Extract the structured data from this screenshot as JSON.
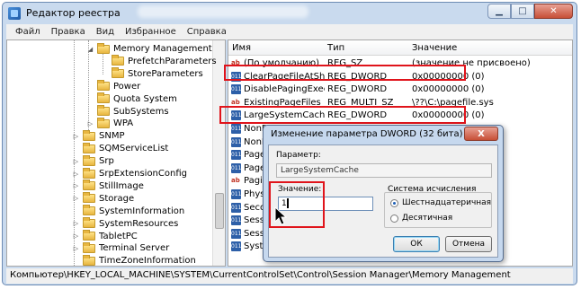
{
  "window": {
    "title": "Редактор реестра"
  },
  "menu": [
    "Файл",
    "Правка",
    "Вид",
    "Избранное",
    "Справка"
  ],
  "tree": [
    {
      "label": "Memory Management",
      "level": 3,
      "expander": "◢"
    },
    {
      "label": "PrefetchParameters",
      "level": 4,
      "expander": ""
    },
    {
      "label": "StoreParameters",
      "level": 4,
      "expander": ""
    },
    {
      "label": "Power",
      "level": 3,
      "expander": ""
    },
    {
      "label": "Quota System",
      "level": 3,
      "expander": ""
    },
    {
      "label": "SubSystems",
      "level": 3,
      "expander": ""
    },
    {
      "label": "WPA",
      "level": 3,
      "expander": "▷"
    },
    {
      "label": "SNMP",
      "level": 2,
      "expander": "▷"
    },
    {
      "label": "SQMServiceList",
      "level": 2,
      "expander": ""
    },
    {
      "label": "Srp",
      "level": 2,
      "expander": "▷"
    },
    {
      "label": "SrpExtensionConfig",
      "level": 2,
      "expander": "▷"
    },
    {
      "label": "StillImage",
      "level": 2,
      "expander": "▷"
    },
    {
      "label": "Storage",
      "level": 2,
      "expander": "▷"
    },
    {
      "label": "SystemInformation",
      "level": 2,
      "expander": ""
    },
    {
      "label": "SystemResources",
      "level": 2,
      "expander": "▷"
    },
    {
      "label": "TabletPC",
      "level": 2,
      "expander": "▷"
    },
    {
      "label": "Terminal Server",
      "level": 2,
      "expander": "▷"
    },
    {
      "label": "TimeZoneInformation",
      "level": 2,
      "expander": ""
    }
  ],
  "values_header": {
    "name": "Имя",
    "type": "Тип",
    "value": "Значение"
  },
  "values": [
    {
      "name": "(По умолчанию)",
      "type": "REG_SZ",
      "value": "(значение не присвоено)",
      "icon": "string"
    },
    {
      "name": "ClearPageFileAtShu...",
      "type": "REG_DWORD",
      "value": "0x00000000 (0)",
      "icon": "binary"
    },
    {
      "name": "DisablePagingExecu...",
      "type": "REG_DWORD",
      "value": "0x00000000 (0)",
      "icon": "binary"
    },
    {
      "name": "ExistingPageFiles",
      "type": "REG_MULTI_SZ",
      "value": "\\??\\C:\\pagefile.sys",
      "icon": "string"
    },
    {
      "name": "LargeSystemCache",
      "type": "REG_DWORD",
      "value": "0x00000000 (0)",
      "icon": "binary"
    },
    {
      "name": "NonPa",
      "type": "",
      "value": "",
      "icon": "binary"
    },
    {
      "name": "NonPa",
      "type": "",
      "value": "",
      "icon": "binary"
    },
    {
      "name": "Paged",
      "type": "",
      "value": "",
      "icon": "binary"
    },
    {
      "name": "Paged",
      "type": "",
      "value": "",
      "icon": "binary"
    },
    {
      "name": "Paging",
      "type": "",
      "value": "",
      "icon": "string"
    },
    {
      "name": "Physic",
      "type": "",
      "value": "",
      "icon": "binary"
    },
    {
      "name": "Secon",
      "type": "",
      "value": "",
      "icon": "binary"
    },
    {
      "name": "Sessio",
      "type": "",
      "value": "",
      "icon": "binary"
    },
    {
      "name": "Sessio",
      "type": "",
      "value": "",
      "icon": "binary"
    },
    {
      "name": "System",
      "type": "",
      "value": "",
      "icon": "binary"
    }
  ],
  "status_path": "Компьютер\\HKEY_LOCAL_MACHINE\\SYSTEM\\CurrentControlSet\\Control\\Session Manager\\Memory Management",
  "dialog": {
    "title": "Изменение параметра DWORD (32 бита)",
    "param_label": "Параметр:",
    "param_value": "LargeSystemCache",
    "value_label": "Значение:",
    "value_input": "1",
    "radix_group": "Система исчисления",
    "radix_hex": "Шестнадцатеричная",
    "radix_dec": "Десятичная",
    "ok": "ОК",
    "cancel": "Отмена",
    "close": "X"
  },
  "colors": {
    "highlight": "#e0141b",
    "frame": "#c9daee"
  },
  "icons": {
    "close": "close-icon",
    "min": "minimize-icon",
    "max": "maximize-icon"
  }
}
